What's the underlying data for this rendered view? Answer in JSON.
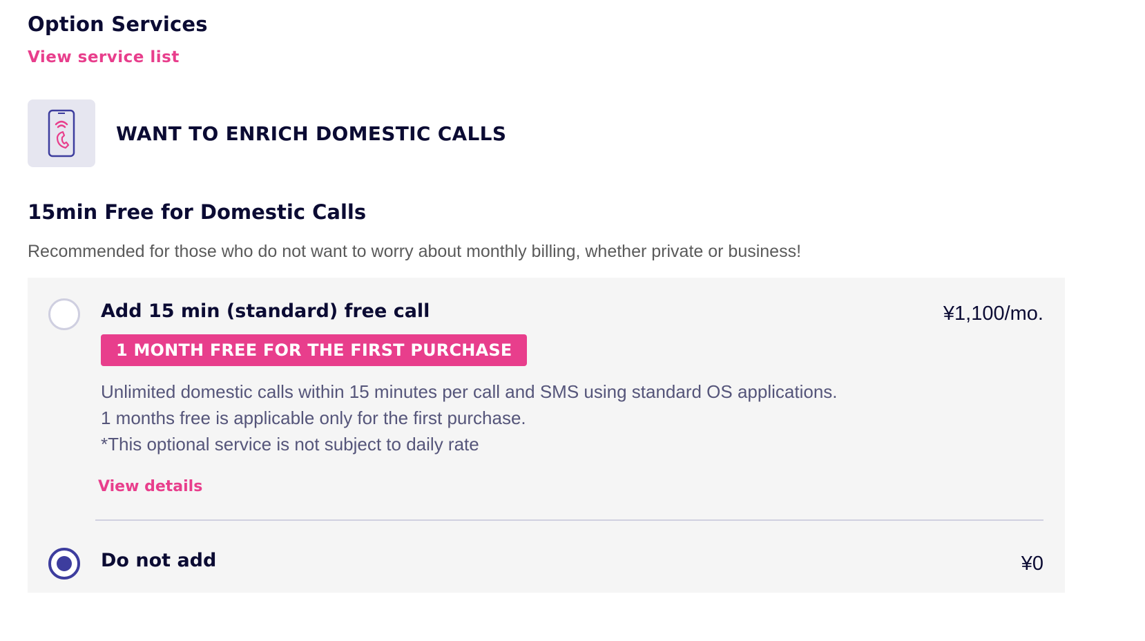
{
  "section": {
    "title": "Option Services",
    "service_list_link": "View service list"
  },
  "category": {
    "icon": "phone-call-icon",
    "title": "WANT TO ENRICH DOMESTIC CALLS"
  },
  "plan": {
    "title": "15min Free for Domestic Calls",
    "description": "Recommended for those who do not want to worry about monthly billing, whether private or business!"
  },
  "options": [
    {
      "label": "Add 15 min (standard) free call",
      "price": "¥1,100/mo.",
      "selected": false,
      "badge": "1 MONTH FREE FOR THE FIRST PURCHASE",
      "description_lines": [
        "Unlimited domestic calls within 15 minutes per call and SMS using standard OS applications.",
        "1 months free is applicable only for the first purchase.",
        "*This optional service is not subject to daily rate"
      ],
      "details_link": "View details"
    },
    {
      "label": "Do not add",
      "price": "¥0",
      "selected": true
    }
  ],
  "colors": {
    "accent_pink": "#e83e8c",
    "navy_text": "#0b0b33",
    "radio_selected": "#3d3d9e",
    "panel_bg": "#f5f5f5",
    "icon_box_bg": "#e6e6f0"
  }
}
